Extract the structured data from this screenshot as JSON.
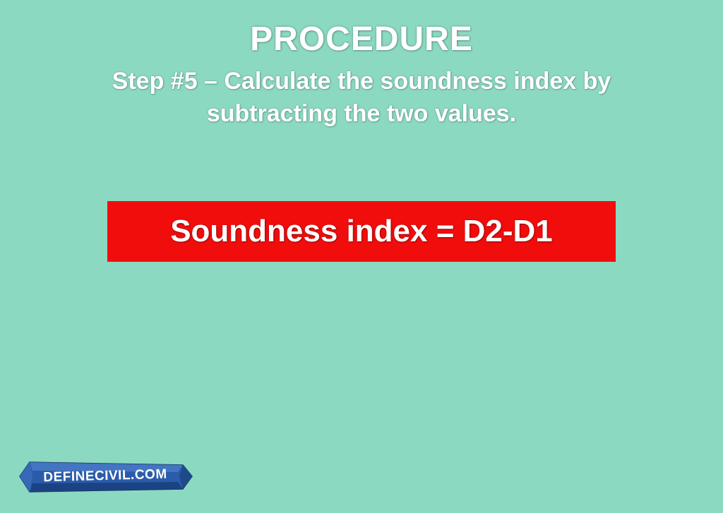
{
  "slide": {
    "title": "PROCEDURE",
    "subtitle": "Step #5 – Calculate the soundness index by subtracting the two values.",
    "formula": "Soundness index = D2-D1"
  },
  "logo": {
    "text": "DEFINECIVIL.COM"
  }
}
